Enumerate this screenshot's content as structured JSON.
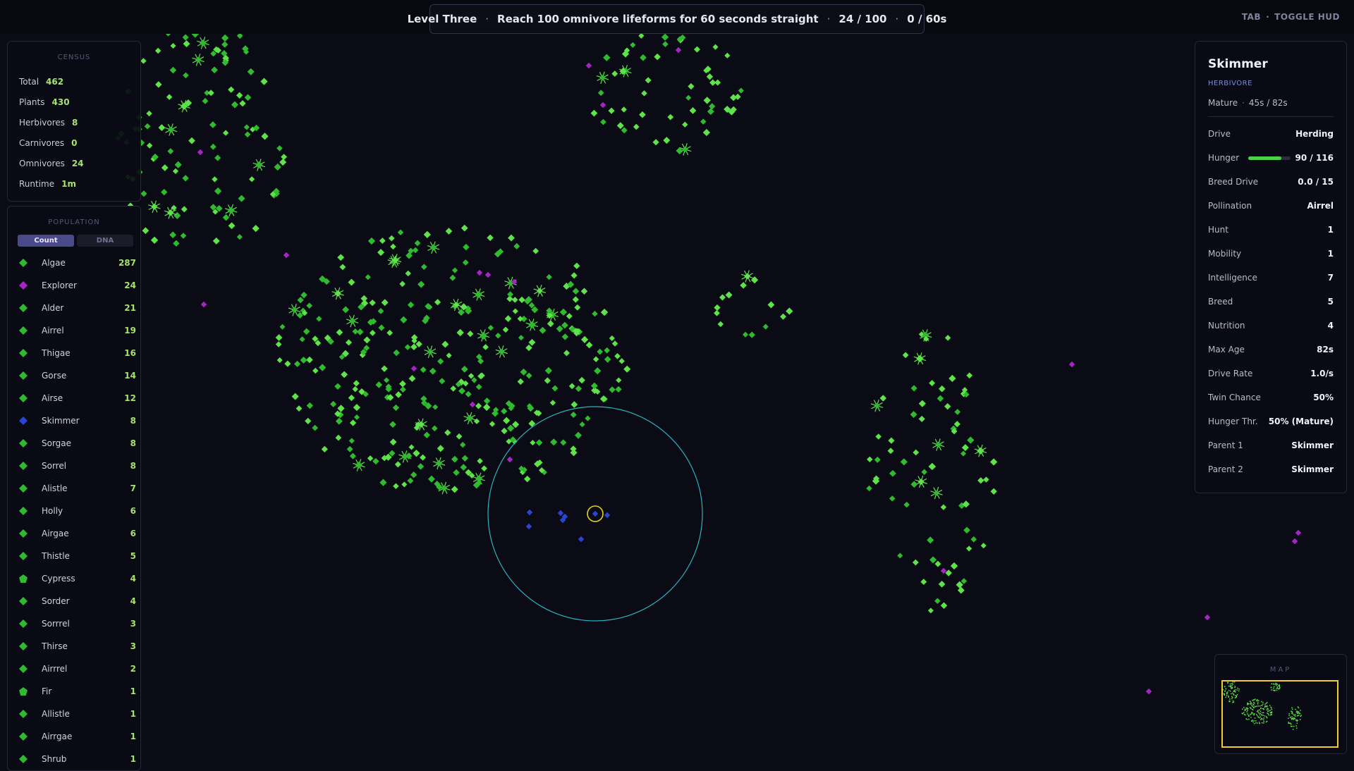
{
  "colors": {
    "plant": "#2fba2f",
    "plant_light": "#5fe34a",
    "omnivore": "#a526c4",
    "herbivore": "#2a44d6",
    "selection": "#e8d218",
    "sense_range": "#2bb3c2",
    "accent_value": "#a6e36b"
  },
  "objective": {
    "level": "Level Three",
    "goal": "Reach 100 omnivore lifeforms for 60 seconds straight",
    "progress": "24 / 100",
    "timer": "0 / 60s"
  },
  "hud_hint": {
    "key": "TAB",
    "action": "TOGGLE HUD"
  },
  "census": {
    "title": "CENSUS",
    "rows": [
      {
        "label": "Total",
        "value": "462"
      },
      {
        "label": "Plants",
        "value": "430"
      },
      {
        "label": "Herbivores",
        "value": "8"
      },
      {
        "label": "Carnivores",
        "value": "0"
      },
      {
        "label": "Omnivores",
        "value": "24"
      },
      {
        "label": "Runtime",
        "value": "1m"
      }
    ]
  },
  "population": {
    "title": "POPULATION",
    "tabs": [
      "Count",
      "DNA"
    ],
    "active_tab": "Count",
    "species": [
      {
        "name": "Algae",
        "count": "287",
        "color": "#2fba2f",
        "icon": "diamond-icon"
      },
      {
        "name": "Explorer",
        "count": "24",
        "color": "#a526c4",
        "icon": "diamond-icon"
      },
      {
        "name": "Alder",
        "count": "21",
        "color": "#2fba2f",
        "icon": "diamond-icon"
      },
      {
        "name": "Airrel",
        "count": "19",
        "color": "#2fba2f",
        "icon": "diamond-icon"
      },
      {
        "name": "Thigae",
        "count": "16",
        "color": "#2fba2f",
        "icon": "diamond-icon"
      },
      {
        "name": "Gorse",
        "count": "14",
        "color": "#2fba2f",
        "icon": "diamond-icon"
      },
      {
        "name": "Airse",
        "count": "12",
        "color": "#2fba2f",
        "icon": "diamond-icon"
      },
      {
        "name": "Skimmer",
        "count": "8",
        "color": "#2a44d6",
        "icon": "diamond-icon"
      },
      {
        "name": "Sorgae",
        "count": "8",
        "color": "#2fba2f",
        "icon": "diamond-icon"
      },
      {
        "name": "Sorrel",
        "count": "8",
        "color": "#2fba2f",
        "icon": "diamond-icon"
      },
      {
        "name": "Alistle",
        "count": "7",
        "color": "#2fba2f",
        "icon": "diamond-icon"
      },
      {
        "name": "Holly",
        "count": "6",
        "color": "#2fba2f",
        "icon": "diamond-icon"
      },
      {
        "name": "Airgae",
        "count": "6",
        "color": "#2fba2f",
        "icon": "diamond-icon"
      },
      {
        "name": "Thistle",
        "count": "5",
        "color": "#2fba2f",
        "icon": "diamond-icon"
      },
      {
        "name": "Cypress",
        "count": "4",
        "color": "#2fba2f",
        "icon": "pentagon-icon"
      },
      {
        "name": "Sorder",
        "count": "4",
        "color": "#2fba2f",
        "icon": "diamond-icon"
      },
      {
        "name": "Sorrrel",
        "count": "3",
        "color": "#2fba2f",
        "icon": "diamond-icon"
      },
      {
        "name": "Thirse",
        "count": "3",
        "color": "#2fba2f",
        "icon": "diamond-icon"
      },
      {
        "name": "Airrrel",
        "count": "2",
        "color": "#2fba2f",
        "icon": "diamond-icon"
      },
      {
        "name": "Fir",
        "count": "1",
        "color": "#2fba2f",
        "icon": "pentagon-icon"
      },
      {
        "name": "Allistle",
        "count": "1",
        "color": "#2fba2f",
        "icon": "diamond-icon"
      },
      {
        "name": "Airrgae",
        "count": "1",
        "color": "#2fba2f",
        "icon": "diamond-icon"
      },
      {
        "name": "Shrub",
        "count": "1",
        "color": "#2fba2f",
        "icon": "diamond-icon"
      }
    ]
  },
  "inspector": {
    "name": "Skimmer",
    "role": "HERBIVORE",
    "stage": "Mature",
    "age": "45s / 82s",
    "hunger_fraction": 0.78,
    "stats": [
      {
        "label": "Drive",
        "value": "Herding"
      },
      {
        "label": "Hunger",
        "value": "90 / 116"
      },
      {
        "label": "Breed Drive",
        "value": "0.0 / 15"
      },
      {
        "label": "Pollination",
        "value": "Airrel"
      },
      {
        "label": "Hunt",
        "value": "1"
      },
      {
        "label": "Mobility",
        "value": "1"
      },
      {
        "label": "Intelligence",
        "value": "7"
      },
      {
        "label": "Breed",
        "value": "5"
      },
      {
        "label": "Nutrition",
        "value": "4"
      },
      {
        "label": "Max Age",
        "value": "82s"
      },
      {
        "label": "Drive Rate",
        "value": "1.0/s"
      },
      {
        "label": "Twin Chance",
        "value": "50%"
      },
      {
        "label": "Hunger Thr.",
        "value": "50% (Mature)"
      },
      {
        "label": "Parent 1",
        "value": "Skimmer"
      },
      {
        "label": "Parent 2",
        "value": "Skimmer"
      }
    ]
  },
  "minimap": {
    "title": "MAP"
  }
}
